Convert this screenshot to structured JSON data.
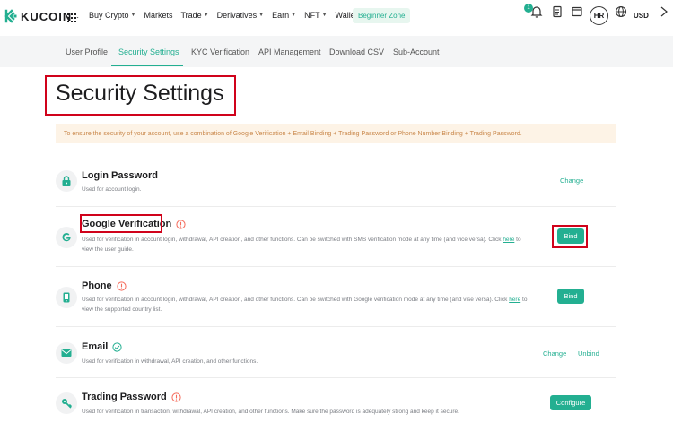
{
  "brand": {
    "name": "KUCOIN",
    "accent": "#23af91",
    "highlight": "#d0021b"
  },
  "nav": {
    "items": [
      {
        "label": "Buy Crypto",
        "caret": true
      },
      {
        "label": "Markets",
        "caret": false
      },
      {
        "label": "Trade",
        "caret": true
      },
      {
        "label": "Derivatives",
        "caret": true
      },
      {
        "label": "Earn",
        "caret": true
      },
      {
        "label": "NFT",
        "caret": true
      },
      {
        "label": "Wallet",
        "caret": true
      }
    ],
    "beginner": "Beginner Zone",
    "notification_count": "1",
    "avatar": "HR",
    "currency": "USD"
  },
  "tabs": [
    "User Profile",
    "Security Settings",
    "KYC Verification",
    "API Management",
    "Download CSV",
    "Sub-Account"
  ],
  "page": {
    "title": "Security Settings",
    "notice": "To ensure the security of your account, use a combination of Google Verification + Email Binding + Trading Password or Phone Number Binding + Trading Password."
  },
  "rows": {
    "login": {
      "title": "Login Password",
      "desc": "Used for account login.",
      "action": "Change"
    },
    "google": {
      "title": "Google Verification",
      "desc_a": "Used for verification in account login, withdrawal, API creation, and other functions. Can be switched with SMS verification mode at any time (and vice versa). Click ",
      "link": "here",
      "desc_b": " to view the user guide.",
      "action": "Bind"
    },
    "phone": {
      "title": "Phone",
      "desc_a": "Used for verification in account login, withdrawal, API creation, and other functions. Can be switched with Google verification mode at any time (and vise versa). Click ",
      "link": "here",
      "desc_b": " to view the supported country list.",
      "action": "Bind"
    },
    "email": {
      "title": "Email",
      "desc": "Used for verification in withdrawal, API creation, and other functions.",
      "action_change": "Change",
      "action_unbind": "Unbind"
    },
    "trading": {
      "title": "Trading Password",
      "desc": "Used for verification in transaction, withdrawal, API creation, and other functions. Make sure the password is adequately strong and keep it secure.",
      "action": "Configure"
    }
  }
}
